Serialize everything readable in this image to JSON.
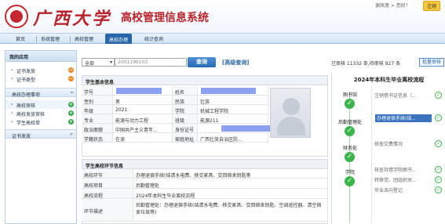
{
  "header": {
    "logo_text": "广西大学",
    "system_title": "高校管理信息系统",
    "user_greeting": "谢凤莲 > 您好！",
    "logout_label": "注销"
  },
  "nav": [
    "首页",
    "系统管理",
    "高校管理",
    "高校办理",
    "统计查询"
  ],
  "sidebar": {
    "title": "我的应用",
    "items_top": [
      {
        "label": "证书发放",
        "badge": "−"
      },
      {
        "label": "证书类型",
        "badge": "−"
      }
    ],
    "group1": "高校办理事项",
    "items_mid": [
      {
        "label": "高校审核",
        "badge": "+"
      },
      {
        "label": "高校发放审核",
        "badge": "+"
      },
      {
        "label": "学生高校单",
        "badge": "+"
      }
    ],
    "group2": "证书发放"
  },
  "search": {
    "select_value": "全部",
    "input_value": "2001190103",
    "button_label": "查询",
    "advanced_label": "[高级查询]"
  },
  "stats": "已审核 11332 条,待审核 927 条",
  "batch_label": "批量审核",
  "student_info": {
    "title": "学生基本信息",
    "rows": [
      {
        "l1": "学号",
        "v1": "",
        "l2": "姓名",
        "v2": ""
      },
      {
        "l1": "性别",
        "v1": "男",
        "l2": "民族",
        "v2": "壮族"
      },
      {
        "l1": "年级",
        "v1": "2021",
        "l2": "学院",
        "v2": "机械工程学院"
      },
      {
        "l1": "专业",
        "v1": "能源与动力工程",
        "l2": "班级",
        "v2": "能源211"
      },
      {
        "l1": "政治面貌",
        "v1": "中国共产主义青年...",
        "l2": "身份证号",
        "v2": ""
      },
      {
        "l1": "学籍状态",
        "v1": "在读",
        "l2": "家庭地址",
        "v2": "广西壮族自治区防..."
      }
    ]
  },
  "leave_info": {
    "title": "学生高校环节信息",
    "rows": [
      {
        "label": "高校环节",
        "value": "办理退宿手续(结清水电费、移交家具、交回宿舍钥匙等"
      },
      {
        "label": "高校项目",
        "value": "后勤管理处"
      },
      {
        "label": "高校流程",
        "value": "2024年本科生毕业离校流程"
      },
      {
        "label": "环节描述",
        "value": "后勤管理处：办理退宿手续(结清水电费、移交家具、交回宿舍钥匙、空调遥控器、清空宿舍垃圾等)"
      }
    ]
  },
  "flow": {
    "title": "2024年本科生毕业离校流程",
    "steps": [
      {
        "dept": "图书馆",
        "items": [
          "注销借书证信息（..."
        ]
      },
      {
        "dept": "后勤管理处",
        "items": [
          "办理退宿手续(结..."
        ]
      },
      {
        "dept": "财务处",
        "items": [
          "核查交费情况"
        ]
      },
      {
        "dept": "学院",
        "items": [
          "核查持借学院图书...",
          "转移党、团组织关...",
          "毕业去向登记"
        ]
      }
    ]
  },
  "colors": {
    "brand_red": "#b8242c",
    "nav_active": "#2866a8",
    "check_green": "#3bb54a",
    "redact": "#8da0f0"
  }
}
